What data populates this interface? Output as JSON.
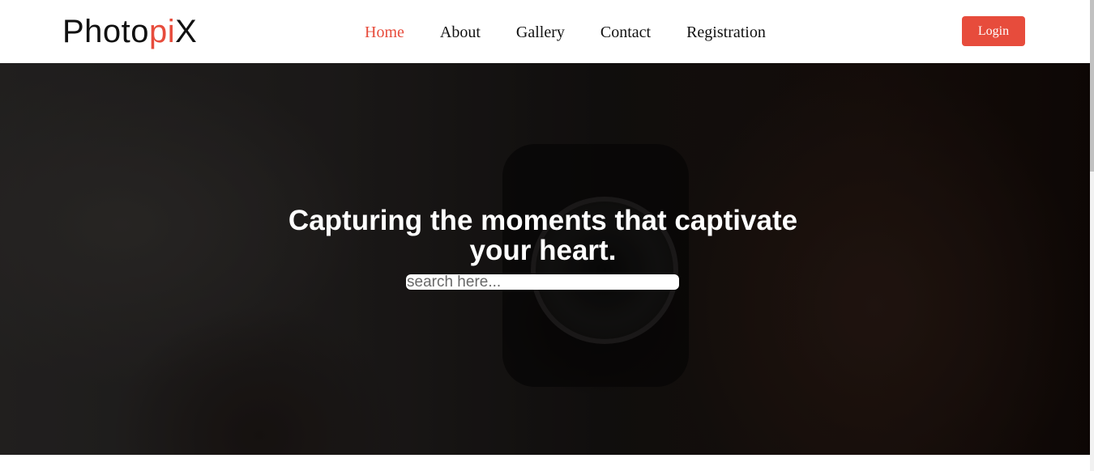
{
  "brand": {
    "name_prefix": "Photo",
    "name_accent": "pi",
    "name_suffix": "X",
    "accent_color": "#e74c3c"
  },
  "nav": {
    "items": [
      {
        "label": "Home",
        "active": true
      },
      {
        "label": "About",
        "active": false
      },
      {
        "label": "Gallery",
        "active": false
      },
      {
        "label": "Contact",
        "active": false
      },
      {
        "label": "Registration",
        "active": false
      }
    ],
    "login_label": "Login"
  },
  "hero": {
    "title": "Capturing the moments that captivate your heart.",
    "search_placeholder": "search here...",
    "image_subject": "person-with-camera-photo"
  }
}
